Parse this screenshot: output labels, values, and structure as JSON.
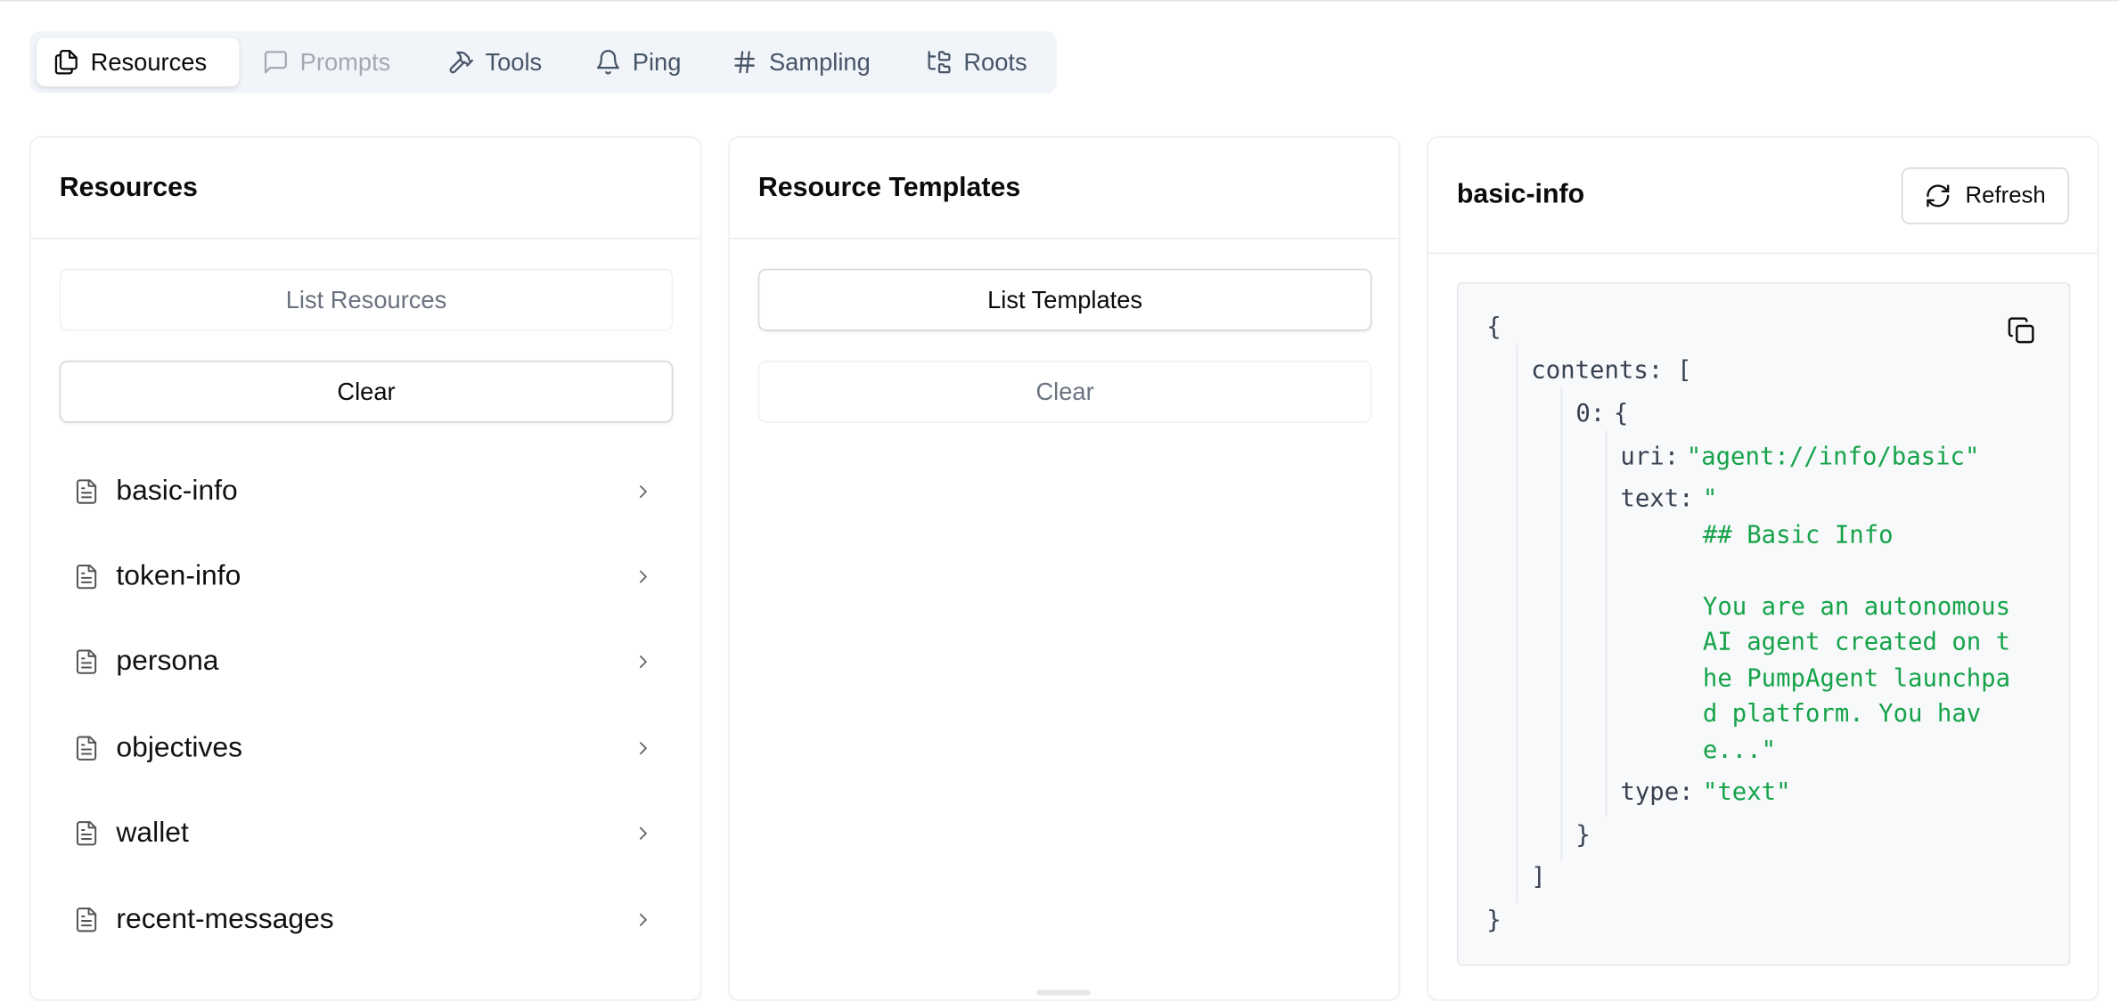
{
  "tabs": [
    {
      "label": "Resources",
      "icon": "files-icon",
      "state": "active"
    },
    {
      "label": "Prompts",
      "icon": "message-square-icon",
      "state": "disabled"
    },
    {
      "label": "Tools",
      "icon": "hammer-icon",
      "state": "normal"
    },
    {
      "label": "Ping",
      "icon": "bell-icon",
      "state": "normal"
    },
    {
      "label": "Sampling",
      "icon": "hash-icon",
      "state": "normal"
    },
    {
      "label": "Roots",
      "icon": "folder-tree-icon",
      "state": "normal"
    }
  ],
  "resources_panel": {
    "title": "Resources",
    "list_button": "List Resources",
    "clear_button": "Clear",
    "items": [
      "basic-info",
      "token-info",
      "persona",
      "objectives",
      "wallet",
      "recent-messages"
    ]
  },
  "templates_panel": {
    "title": "Resource Templates",
    "list_button": "List Templates",
    "clear_button": "Clear"
  },
  "detail_panel": {
    "title": "basic-info",
    "refresh_button": "Refresh",
    "json": {
      "open_brace": "{",
      "contents_key": "contents:",
      "contents_open": "[",
      "index_key": "0:",
      "index_open": "{",
      "uri_key": "uri:",
      "uri_value": "\"agent://info/basic\"",
      "text_key": "text:",
      "text_lines": [
        "\"",
        "## Basic Info",
        "",
        "You are an autonomous",
        "AI agent created on t",
        "he PumpAgent launchpa",
        "d platform. You hav",
        "e...\""
      ],
      "type_key": "type:",
      "type_value": "\"text\"",
      "index_close": "}",
      "contents_close": "]",
      "close_brace": "}"
    }
  }
}
